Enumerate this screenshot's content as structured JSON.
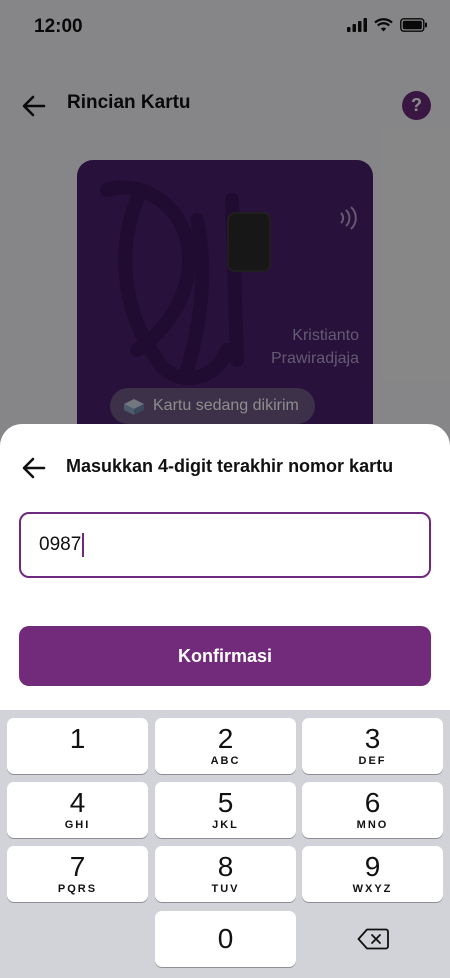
{
  "status_bar": {
    "time": "12:00"
  },
  "header": {
    "title": "Rincian Kartu",
    "help_label": "?"
  },
  "card": {
    "holder_line1": "Kristianto",
    "holder_line2": "Prawiradjaja",
    "status_pill": "Kartu sedang dikirim"
  },
  "sheet": {
    "title": "Masukkan 4-digit terakhir nomor kartu",
    "input_value": "0987",
    "confirm_label": "Konfirmasi"
  },
  "keypad": {
    "keys": [
      {
        "num": "1",
        "letters": ""
      },
      {
        "num": "2",
        "letters": "ABC"
      },
      {
        "num": "3",
        "letters": "DEF"
      },
      {
        "num": "4",
        "letters": "GHI"
      },
      {
        "num": "5",
        "letters": "JKL"
      },
      {
        "num": "6",
        "letters": "MNO"
      },
      {
        "num": "7",
        "letters": "PQRS"
      },
      {
        "num": "8",
        "letters": "TUV"
      },
      {
        "num": "9",
        "letters": "WXYZ"
      },
      {
        "num": "0",
        "letters": ""
      }
    ]
  },
  "colors": {
    "brand": "#722b7a",
    "card": "#4a1f6b"
  }
}
